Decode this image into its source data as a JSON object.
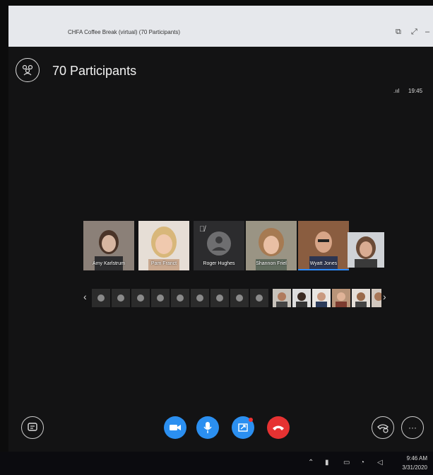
{
  "window": {
    "title": "CHFA Coffee Break (virtual) (70 Participants)"
  },
  "header": {
    "participants_label": "70 Participants",
    "signal": ".ııl",
    "time": "19:45"
  },
  "video_tiles": [
    {
      "name": "Amy Karlstrum",
      "icon": "person-photo"
    },
    {
      "name": "Pam Franct",
      "icon": "person-photo"
    },
    {
      "name": "Roger Hughes",
      "icon": "default-avatar-icon",
      "muted": true
    },
    {
      "name": "Shannon Friel",
      "icon": "person-photo"
    },
    {
      "name": "Wyatt Jones",
      "icon": "person-photo",
      "active": true
    }
  ],
  "strip": {
    "prev_arrow": "‹",
    "next_arrow": "›"
  },
  "controls": {
    "chat": "chat-icon",
    "video": "video-camera-icon",
    "mic": "microphone-icon",
    "share": "share-screen-icon",
    "hangup": "hang-up-icon",
    "call_control": "phone-settings-icon",
    "more": "···"
  },
  "taskbar": {
    "time": "9:46 AM",
    "date": "3/31/2020"
  }
}
